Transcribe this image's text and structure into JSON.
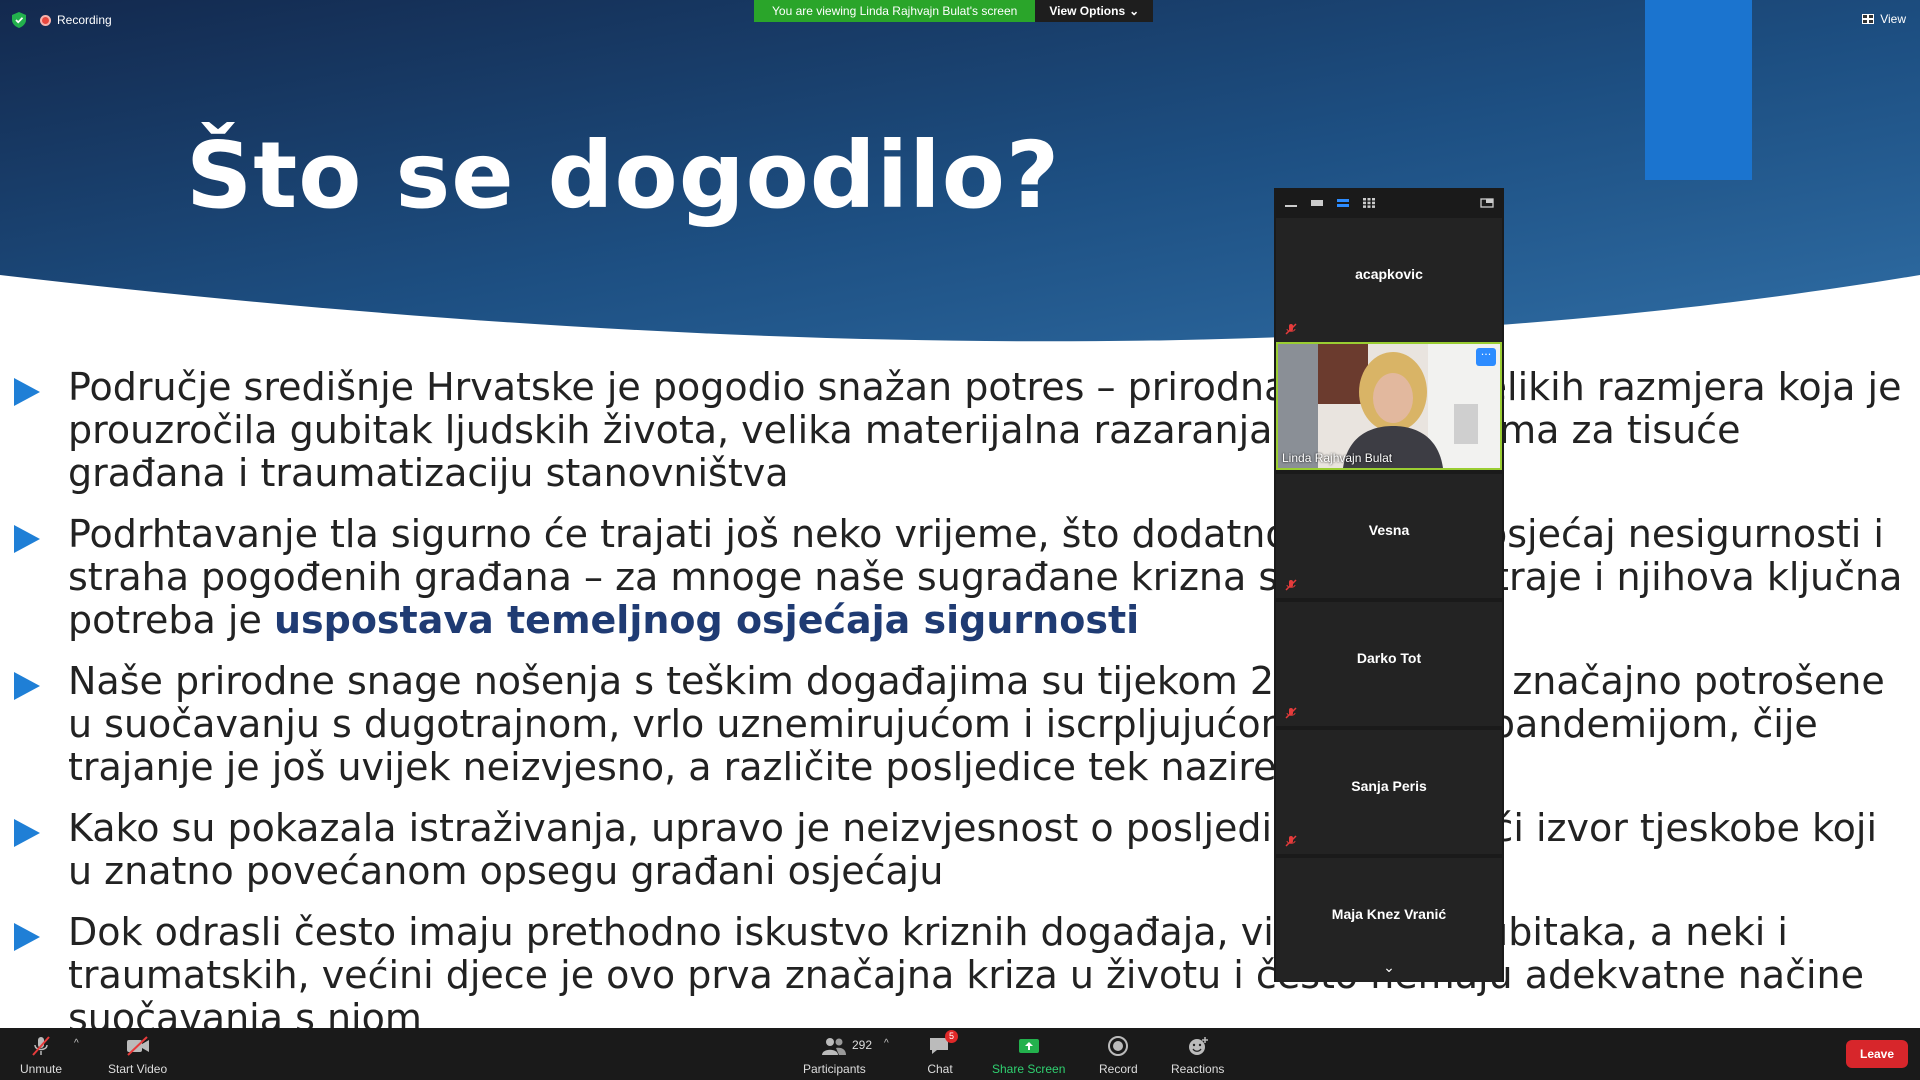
{
  "app": {
    "recording_label": "Recording",
    "share_banner": "You are viewing Linda Rajhvajn Bulat's screen",
    "view_options_label": "View Options",
    "view_label": "View"
  },
  "slide": {
    "title": "Što se dogodilo?",
    "bullets": [
      {
        "text": "Područje središnje Hrvatske je pogodio snažan potres – prirodna nesreća velikih razmjera koja je prouzročila gubitak ljudskih života, velika materijalna razaranja, gubitak doma za tisuće građana i traumatizaciju stanovništva"
      },
      {
        "text_before": "Podrhtavanje tla sigurno će trajati još neko vrijeme, što dodatno pojačava osjećaj nesigurnosti i straha pogođenih građana – za mnoge naše sugrađane krizna situacija još traje i njihova ključna potreba je ",
        "highlight": "uspostava temeljnog osjećaja sigurnosti"
      },
      {
        "text": "Naše prirodne snage nošenja s teškim događajima su tijekom 2020. godine značajno potrošene u suočavanju s dugotrajnom, vrlo uznemirujućom i iscrpljujućom Covid-19 pandemijom, čije trajanje je još uvijek neizvjesno, a različite posljedice tek naziremo naziru"
      },
      {
        "text": "Kako su pokazala istraživanja, upravo je neizvjesnost o posljedicama najveći izvor tjeskobe koji u znatno povećanom opsegu građani osjećaju"
      },
      {
        "text": "Dok odrasli često imaju prethodno iskustvo kriznih događaja, višestrukih gubitaka, a neki i traumatskih, većini djece je ovo prva značajna kriza u životu i često nemaju adekvatne načine suočavanja s njom"
      }
    ]
  },
  "gallery": {
    "participants": [
      {
        "name": "acapkovic",
        "muted": true
      },
      {
        "name": "Linda Rajhvajn Bulat",
        "video": true,
        "more_label": "···"
      },
      {
        "name": "Vesna",
        "muted": true
      },
      {
        "name": "Darko Tot",
        "muted": true
      },
      {
        "name": "Sanja Peris",
        "muted": true
      },
      {
        "name": "Maja Knez Vranić",
        "muted": false
      }
    ]
  },
  "toolbar": {
    "unmute": "Unmute",
    "start_video": "Start Video",
    "participants": "Participants",
    "participants_count": "292",
    "chat": "Chat",
    "chat_badge": "5",
    "share_screen": "Share Screen",
    "record": "Record",
    "reactions": "Reactions",
    "leave": "Leave"
  },
  "colors": {
    "share_banner_bg": "#2aa52a",
    "leave_bg": "#d7262b",
    "bullet_arrow": "#1f7fd6",
    "highlight_text": "#1f3b73",
    "accent_bar": "#1b74cf"
  }
}
